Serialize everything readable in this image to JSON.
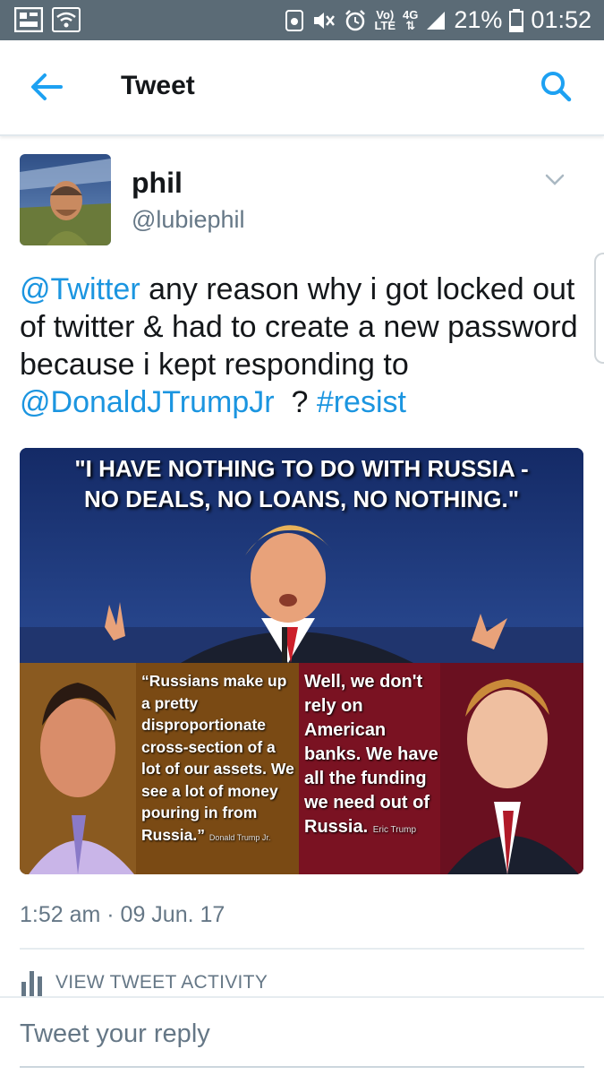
{
  "status_bar": {
    "network_label_top": "Vo)",
    "network_label_bottom": "LTE",
    "data_label": "4G",
    "battery": "21%",
    "time": "01:52"
  },
  "header": {
    "title": "Tweet",
    "back_icon": "back-arrow-icon",
    "search_icon": "search-icon"
  },
  "tweet": {
    "author_name": "phil",
    "author_handle": "@lubiephil",
    "text_parts": [
      {
        "text": "@Twitter",
        "link": true
      },
      {
        "text": " any reason why i got locked out of twitter & had to create a new password because i kept responding to ",
        "link": false
      },
      {
        "text": "@DonaldJTrumpJr",
        "link": true
      },
      {
        "text": "  ? ",
        "link": false
      },
      {
        "text": "#resist",
        "link": true
      }
    ],
    "media": {
      "quote_line1": "\"I HAVE NOTHING TO DO WITH RUSSIA -",
      "quote_line2": "NO DEALS, NO LOANS, NO NOTHING.\"",
      "left_quote": "“Russians make up a pretty disproportionate cross-section of a lot of our assets. We see a lot of money pouring in from Russia.”",
      "left_credit": "Donald Trump Jr.",
      "right_quote": "Well, we don't rely on American banks. We have all the funding we need out of Russia.",
      "right_credit": "Eric Trump"
    },
    "timestamp": "1:52 am · 09 Jun. 17"
  },
  "activity": {
    "label": "VIEW TWEET ACTIVITY"
  },
  "reply": {
    "placeholder": "Tweet your reply"
  },
  "colors": {
    "status_bar": "#5b6b76",
    "link": "#1b95e0",
    "text": "#14171a",
    "secondary": "#657786"
  }
}
